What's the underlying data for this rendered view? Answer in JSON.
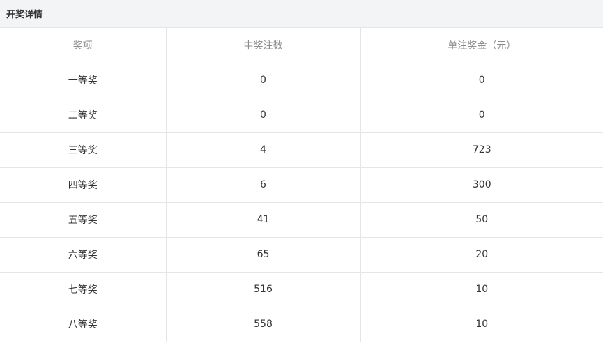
{
  "panel": {
    "title": "开奖详情"
  },
  "table": {
    "headers": [
      "奖项",
      "中奖注数",
      "单注奖金（元）"
    ],
    "rows": [
      [
        "一等奖",
        "0",
        "0"
      ],
      [
        "二等奖",
        "0",
        "0"
      ],
      [
        "三等奖",
        "4",
        "723"
      ],
      [
        "四等奖",
        "6",
        "300"
      ],
      [
        "五等奖",
        "41",
        "50"
      ],
      [
        "六等奖",
        "65",
        "20"
      ],
      [
        "七等奖",
        "516",
        "10"
      ],
      [
        "八等奖",
        "558",
        "10"
      ]
    ]
  }
}
